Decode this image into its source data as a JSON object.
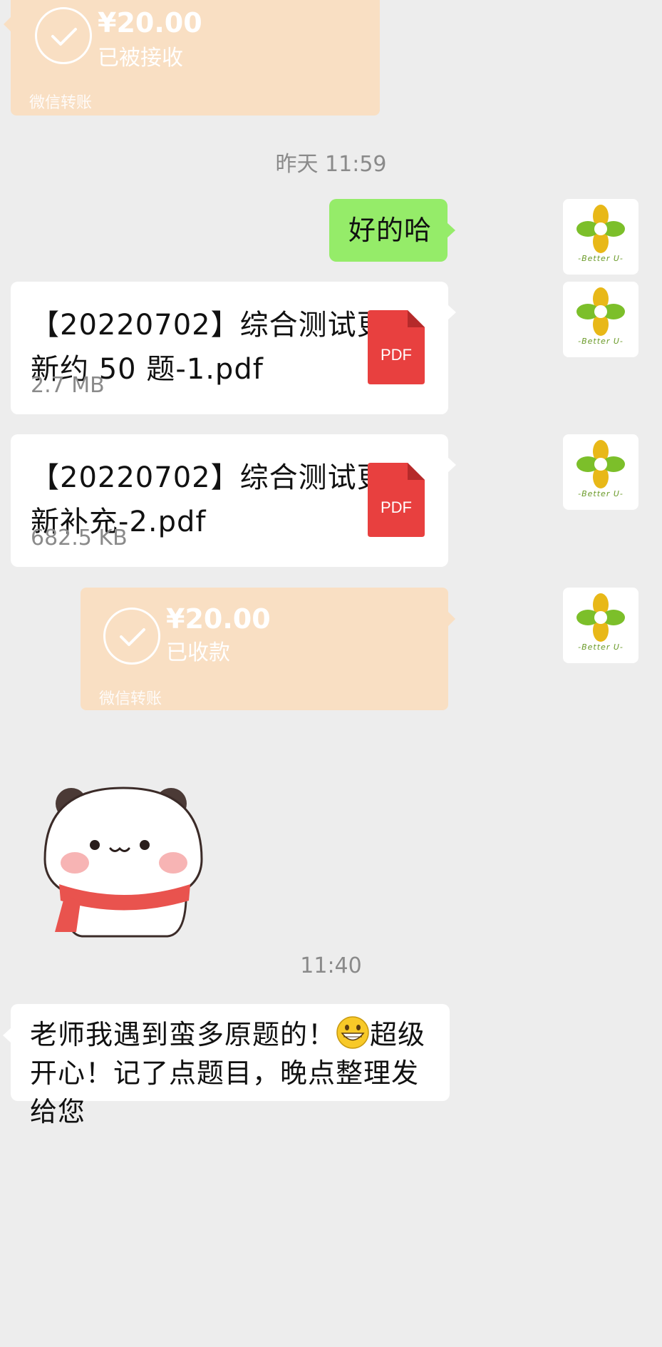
{
  "messages": {
    "transfer_received": {
      "amount": "¥20.00",
      "status": "已被接收",
      "kind": "微信转账"
    },
    "time_yesterday": "昨天 11:59",
    "reply_ok": "好的哈",
    "avatar_brand": "-Better U-",
    "file_1": {
      "name": "【20220702】综合测试更新约 50 题-1.pdf",
      "size": "2.7 MB",
      "type": "PDF"
    },
    "file_2": {
      "name": "【20220702】综合测试更新补充-2.pdf",
      "size": "682.5 KB",
      "type": "PDF"
    },
    "transfer_sent": {
      "amount": "¥20.00",
      "status": "已收款",
      "kind": "微信转账"
    },
    "time_today": "11:40",
    "incoming_text_before_emoji": "老师我遇到蛮多原题的！",
    "incoming_text_after_emoji": "超级开心！记了点题目，晚点整理发给您"
  },
  "colors": {
    "background": "#ededed",
    "green_bubble": "#95ec69",
    "transfer_card": "#f9dfc3",
    "pdf_red": "#e8403f"
  },
  "icons": {
    "check": "check-circle-icon",
    "pdf": "pdf-file-icon",
    "emoji": "grinning-face-emoji",
    "sticker": "panda-sticker"
  }
}
